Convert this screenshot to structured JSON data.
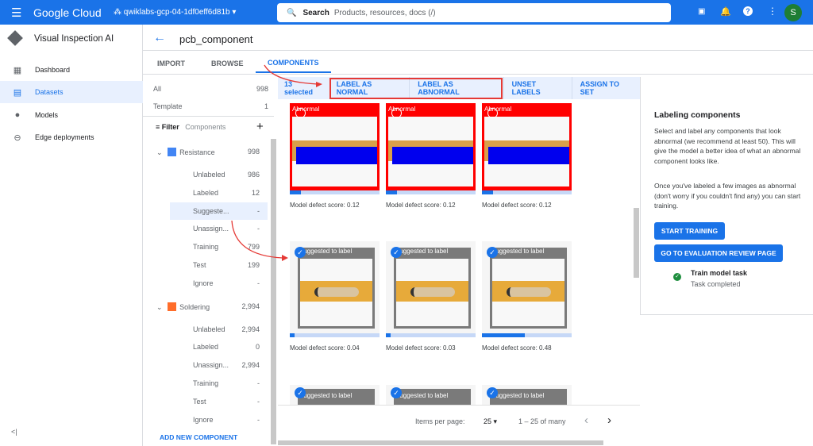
{
  "topbar": {
    "product": "Google Cloud",
    "project": "qwiklabs-gcp-04-1df0eff6d81b",
    "search_label": "Search",
    "search_placeholder": "Products, resources, docs (/)",
    "avatar": "S"
  },
  "nav": {
    "title": "Visual Inspection AI",
    "items": [
      {
        "label": "Dashboard",
        "icon": "dashboard-icon"
      },
      {
        "label": "Datasets",
        "icon": "datasets-icon",
        "active": true
      },
      {
        "label": "Models",
        "icon": "lightbulb-icon"
      },
      {
        "label": "Edge deployments",
        "icon": "edge-icon"
      }
    ],
    "collapse": "<|"
  },
  "header": {
    "title": "pcb_component"
  },
  "tabs": [
    {
      "label": "IMPORT"
    },
    {
      "label": "BROWSE"
    },
    {
      "label": "COMPONENTS",
      "active": true
    }
  ],
  "left": {
    "all_label": "All",
    "all_count": "998",
    "template_label": "Template",
    "template_count": "1",
    "filter_label": "Filter",
    "filter_placeholder": "Components",
    "groups": [
      {
        "name": "Resistance",
        "count": "998",
        "color": "#4285f4",
        "rows": [
          [
            "Unlabeled",
            "986"
          ],
          [
            "Labeled",
            "12"
          ],
          [
            "Suggeste...",
            "-"
          ],
          [
            "Unassign...",
            "-"
          ],
          [
            "Training",
            "799"
          ],
          [
            "Test",
            "199"
          ],
          [
            "Ignore",
            "-"
          ]
        ]
      },
      {
        "name": "Soldering",
        "count": "2,994",
        "color": "#ff6d2a",
        "rows": [
          [
            "Unlabeled",
            "2,994"
          ],
          [
            "Labeled",
            "0"
          ],
          [
            "Unassign...",
            "2,994"
          ],
          [
            "Training",
            "-"
          ],
          [
            "Test",
            "-"
          ],
          [
            "Ignore",
            "-"
          ]
        ]
      }
    ],
    "add_label": "ADD NEW COMPONENT"
  },
  "toolbar": {
    "selected": "13 selected",
    "label_normal": "LABEL AS NORMAL",
    "label_abnormal": "LABEL AS ABNORMAL",
    "unset": "UNSET LABELS",
    "assign": "ASSIGN TO SET"
  },
  "cards": [
    {
      "tag": "Abnormal",
      "score_label": "Model defect score: 0.12",
      "score": 0.12,
      "type": "abnormal"
    },
    {
      "tag": "Abnormal",
      "score_label": "Model defect score: 0.12",
      "score": 0.12,
      "type": "abnormal"
    },
    {
      "tag": "Abnormal",
      "score_label": "Model defect score: 0.12",
      "score": 0.12,
      "type": "abnormal"
    },
    {
      "tag": "Suggested to label",
      "score_label": "Model defect score: 0.04",
      "score": 0.04,
      "type": "suggested"
    },
    {
      "tag": "Suggested to label",
      "score_label": "Model defect score: 0.03",
      "score": 0.03,
      "type": "suggested"
    },
    {
      "tag": "Suggested to label",
      "score_label": "Model defect score: 0.48",
      "score": 0.48,
      "type": "suggested"
    },
    {
      "tag": "Suggested to label",
      "type": "suggested"
    },
    {
      "tag": "Suggested to label",
      "type": "suggested"
    },
    {
      "tag": "Suggested to label",
      "type": "suggested"
    }
  ],
  "pagination": {
    "items_label": "Items per page:",
    "per_page": "25",
    "range": "1 – 25 of many"
  },
  "right": {
    "title": "Labeling components",
    "p1": "Select and label any components that look abnormal (we recommend at least 50). This will give the model a better idea of what an abnormal component looks like.",
    "p2": "Once you've labeled a few images as abnormal (don't worry if you couldn't find any) you can start training.",
    "start": "START TRAINING",
    "eval": "GO TO EVALUATION REVIEW PAGE",
    "task_title": "Train model task",
    "task_status": "Task completed"
  }
}
